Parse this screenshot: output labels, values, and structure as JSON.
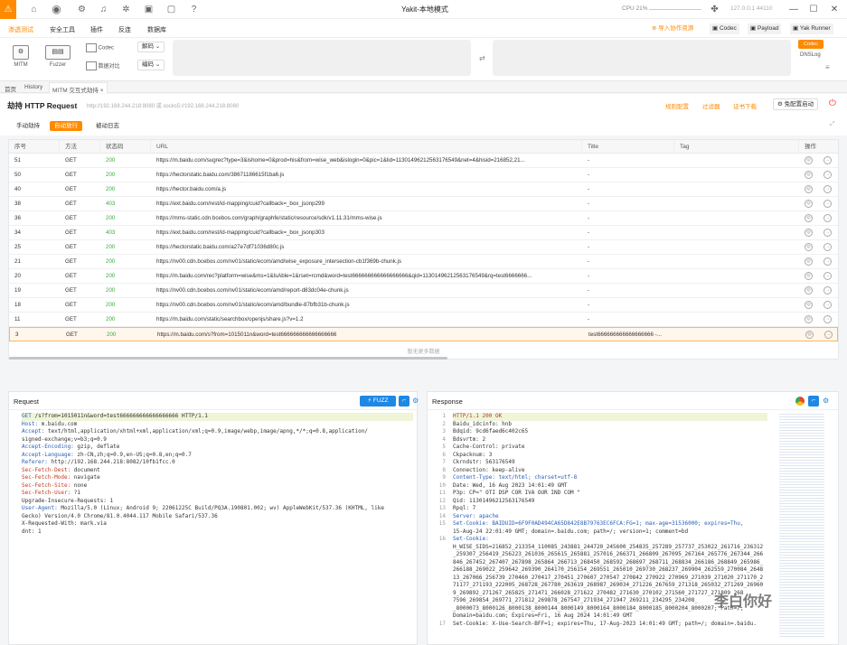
{
  "window": {
    "title": "Yakit-本地模式",
    "cpu": "CPU 21%",
    "ip": "127.0.0.1 44110"
  },
  "menu": {
    "items": [
      "渗透测试",
      "安全工具",
      "插件",
      "反连",
      "数据库"
    ],
    "right": [
      "导入协作资源",
      "Codec",
      "Payload",
      "Yak Runner"
    ]
  },
  "toolbar": {
    "mitm": "MITM",
    "fuzzer": "Fuzzer",
    "codec": "Codec",
    "compare": "数据对比",
    "decode": "解码",
    "encode": "编码",
    "codec_badge": "Codec",
    "dnslog": "DNSLog"
  },
  "tabs": [
    "首页",
    "History",
    "MITM 交互式劫持"
  ],
  "page": {
    "title": "劫持 HTTP Request",
    "proxy": "http://192.168.244.218:8080 或 socks5://192.168.244.218:8080",
    "rule_config": "规则配置",
    "filter": "过滤器",
    "cert": "证书下载",
    "free_config": "免配置启动"
  },
  "subtabs": [
    "手动劫持",
    "自动放行",
    "被动日志"
  ],
  "table": {
    "headers": [
      "序号",
      "方法",
      "状态码",
      "URL",
      "Title",
      "Tag",
      "操作"
    ],
    "rows": [
      {
        "id": "51",
        "method": "GET",
        "status": "200",
        "url": "https://m.baidu.com/sugrec?type=3&ishome=0&prod=his&from=wise_web&islogin=0&pic=1&lid=11301496212563176549&net=4&hisid=216852,21...",
        "title": "-"
      },
      {
        "id": "50",
        "method": "GET",
        "status": "200",
        "url": "https://hectorstatic.baidu.com/38671186615f1ba6.js",
        "title": "-"
      },
      {
        "id": "40",
        "method": "GET",
        "status": "200",
        "url": "https://hector.baidu.com/a.js",
        "title": "-"
      },
      {
        "id": "38",
        "method": "GET",
        "status": "403",
        "url": "https://ext.baidu.com/rest/id-mapping/cuid?callback=_box_jsonp299",
        "title": "-"
      },
      {
        "id": "36",
        "method": "GET",
        "status": "200",
        "url": "https://mms-static.cdn.bcebos.com/graph/graphfe/static/resource/sdk/v1.11.31/mms-wise.js",
        "title": "-"
      },
      {
        "id": "34",
        "method": "GET",
        "status": "403",
        "url": "https://ext.baidu.com/rest/id-mapping/cuid?callback=_box_jsonp303",
        "title": "-"
      },
      {
        "id": "25",
        "method": "GET",
        "status": "200",
        "url": "https://hectorstatic.baidu.com/a27e7df71036d80c.js",
        "title": "-"
      },
      {
        "id": "21",
        "method": "GET",
        "status": "200",
        "url": "https://nv00.cdn.bcebos.com/nv01/static/ecom/amd/wise_exposure_intersection-cb1f369b-chunk.js",
        "title": "-"
      },
      {
        "id": "20",
        "method": "GET",
        "status": "200",
        "url": "https://m.baidu.com/rec?platform=wise&ms=1&lsAble=1&rset=rcmd&word=test666666666666666666&qid=11301496212563176549&rq=test6666666...",
        "title": "-"
      },
      {
        "id": "19",
        "method": "GET",
        "status": "200",
        "url": "https://nv00.cdn.bcebos.com/nv01/static/ecom/amd/report-d83dc04e-chunk.js",
        "title": "-"
      },
      {
        "id": "18",
        "method": "GET",
        "status": "200",
        "url": "https://nv00.cdn.bcebos.com/nv01/static/ecom/amd/bundle-87bfb31b-chunk.js",
        "title": "-"
      },
      {
        "id": "11",
        "method": "GET",
        "status": "200",
        "url": "https://m.baidu.com/static/searchbox/openjs/share.js?v=1.2",
        "title": "-"
      },
      {
        "id": "3",
        "method": "GET",
        "status": "200",
        "url": "https://m.baidu.com/s?from=1015011n&word=test666666666666666666",
        "title": "test666666666666666666 -..."
      }
    ],
    "no_more": "暂无更多数据"
  },
  "request": {
    "title": "Request",
    "fuzz": "FUZZ",
    "lines": [
      {
        "k": "GET",
        "v": " /s?from=1015011n&word=test666666666666666666 HTTP/1.1",
        "hl": true
      },
      {
        "k": "Host:",
        "v": " m.baidu.com"
      },
      {
        "k": "Accept:",
        "v": " text/html,application/xhtml+xml,application/xml;q=0.9,image/webp,image/apng,*/*;q=0.8,application/"
      },
      {
        "k": "",
        "v": "signed-exchange;v=b3;q=0.9"
      },
      {
        "k": "Accept-Encoding:",
        "v": " gzip, deflate"
      },
      {
        "k": "Accept-Language:",
        "v": " zh-CN,zh;q=0.9,en-US;q=0.8,en;q=0.7"
      },
      {
        "k": "Referer:",
        "v": " http://192.168.244.218:8082/10fb1fcc.0"
      },
      {
        "k": "Sec-Fetch-Dest:",
        "v": " document",
        "red": true
      },
      {
        "k": "Sec-Fetch-Mode:",
        "v": " navigate",
        "red": true
      },
      {
        "k": "Sec-Fetch-Site:",
        "v": " none",
        "red": true
      },
      {
        "k": "Sec-Fetch-User:",
        "v": " ?1",
        "red": true
      },
      {
        "k": "",
        "v": "Upgrade-Insecure-Requests: 1"
      },
      {
        "k": "User-Agent:",
        "v": " Mozilla/5.0 (Linux; Android 9; 22061225C Build/PQ3A.190801.002; wv) AppleWebKit/537.36 (KHTML, like"
      },
      {
        "k": "",
        "v": "Gecko) Version/4.0 Chrome/81.0.4044.117 Mobile Safari/537.36"
      },
      {
        "k": "",
        "v": "X-Requested-With: mark.via"
      },
      {
        "k": "",
        "v": "dnt: 1"
      }
    ]
  },
  "response": {
    "title": "Response",
    "lines": [
      {
        "n": "1",
        "t": "HTTP/1.1 200 OK",
        "hl": true
      },
      {
        "n": "2",
        "t": "Baidu_idcinfo: hnb"
      },
      {
        "n": "3",
        "t": "Bdqid: 9cd6faed6c402c65"
      },
      {
        "n": "4",
        "t": "Bdsvrtm: 2"
      },
      {
        "n": "5",
        "t": "Cache-Control: private"
      },
      {
        "n": "6",
        "t": "Ckpacknum: 3"
      },
      {
        "n": "7",
        "t": "Ckrndstr: 563176549"
      },
      {
        "n": "8",
        "t": "Connection: keep-alive"
      },
      {
        "n": "9",
        "t": "Content-Type: text/html; charset=utf-8",
        "blue": true
      },
      {
        "n": "10",
        "t": "Date: Wed, 16 Aug 2023 14:01:49 GMT"
      },
      {
        "n": "11",
        "t": "P3p: CP=\" OTI DSP COR IVA OUR IND COM \""
      },
      {
        "n": "12",
        "t": "Qid: 11301496212563176549"
      },
      {
        "n": "13",
        "t": "Rpql: 7"
      },
      {
        "n": "14",
        "t": "Server: apache",
        "blue": true
      },
      {
        "n": "15",
        "t": "Set-Cookie: BAIDUID=6F9F0AD494CA65D842E8B79763EC6FCA:FG=1; max-age=31536000; expires=Thu,",
        "blue": true
      },
      {
        "n": "",
        "t": "15-Aug-24 22:01:49 GMT; domain=.baidu.com; path=/; version=1; comment=bd"
      },
      {
        "n": "16",
        "t": "Set-Cookie:",
        "blue": true
      },
      {
        "n": "",
        "t": "H_WISE_SIDS=216852_213354_110085_243881_244720_245600_254835_257289_257737_253022_261716_236312"
      },
      {
        "n": "",
        "t": "_259307_256419_256223_261036_265615_265881_257016_266371_266809_267095_267164_265776_267344_266"
      },
      {
        "n": "",
        "t": "846_267452_267407_267898_265864_266713_268450_268592_268697_268711_268834_266186_268849_265986_"
      },
      {
        "n": "",
        "t": "266188_269022_259642_269390_264170_256154_269551_265010_269730_268237_269904_262559_270084_2648"
      },
      {
        "n": "",
        "t": "13_267066_256739_270460_270417_270451_270607_270547_270842_270922_270969_271039_271020_271170_2"
      },
      {
        "n": "",
        "t": "71177_271193_222005_268728_267780_263619_268987_269034_271226_267659_271318_265032_271269_26960"
      },
      {
        "n": "",
        "t": "9_269892_271267_265825_271471_266028_271622_270482_271630_270102_271560_271727_271809_268"
      },
      {
        "n": "",
        "t": "7596_269854_269771_271812_269878_267547_271934_271947_269211_234295_234208_"
      },
      {
        "n": "",
        "t": "_8000073_8000126_8000138_8000144_8000149_8000164_8000184_8000185_8000204_8000207; Path=/;"
      },
      {
        "n": "",
        "t": "Domain=baidu.com; Expires=Fri, 16 Aug 2024 14:01:49 GMT"
      },
      {
        "n": "17",
        "t": "Set-Cookie: X-Use-Search-BFF=1; expires=Thu, 17-Aug-2023 14:01:49 GMT; path=/; domain=.baidu."
      }
    ]
  },
  "watermark": "李白你好"
}
